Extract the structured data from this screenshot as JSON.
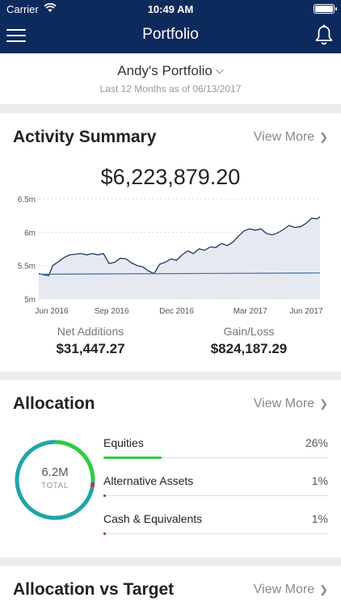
{
  "status_bar": {
    "carrier": "Carrier",
    "time": "10:49 AM"
  },
  "nav": {
    "title": "Portfolio"
  },
  "portfolio": {
    "name": "Andy's Portfolio",
    "subtitle": "Last 12 Months as of 06/13/2017"
  },
  "activity": {
    "title": "Activity Summary",
    "view_more": "View More",
    "total": "$6,223,879.20",
    "net_additions_label": "Net Additions",
    "net_additions_value": "$31,447.27",
    "gain_loss_label": "Gain/Loss",
    "gain_loss_value": "$824,187.29"
  },
  "chart_data": {
    "type": "area",
    "y_ticks": [
      "6.5m",
      "6m",
      "5.5m",
      "5m"
    ],
    "y_tick_values": [
      6.5,
      6.0,
      5.5,
      5.0
    ],
    "ylim": [
      5.0,
      6.5
    ],
    "x_ticks": [
      "Jun 2016",
      "Sep 2016",
      "Dec 2016",
      "Mar 2017",
      "Jun 2017"
    ],
    "x_tick_positions": [
      4.6,
      25.9,
      49.0,
      75.2,
      95.1
    ],
    "series": [
      {
        "kind": "area",
        "color": "#1f3a66",
        "fill": "#e7e9f1",
        "x": [
          0,
          2,
          3.5,
          5,
          7,
          9,
          11,
          13,
          15,
          17,
          19,
          21,
          23,
          25,
          27,
          29,
          31,
          33,
          35,
          37,
          39,
          41,
          43,
          45,
          47,
          49,
          51,
          53,
          55,
          57,
          59,
          61,
          63,
          65,
          67,
          69,
          71,
          73,
          75,
          77,
          79,
          81,
          83,
          85,
          87,
          89,
          91,
          93,
          95,
          97,
          99,
          100
        ],
        "y": [
          5.38,
          5.36,
          5.35,
          5.5,
          5.56,
          5.62,
          5.66,
          5.67,
          5.68,
          5.66,
          5.68,
          5.66,
          5.68,
          5.53,
          5.55,
          5.61,
          5.6,
          5.54,
          5.5,
          5.48,
          5.42,
          5.38,
          5.52,
          5.55,
          5.6,
          5.58,
          5.66,
          5.72,
          5.68,
          5.75,
          5.73,
          5.78,
          5.77,
          5.83,
          5.8,
          5.85,
          5.94,
          6.02,
          6.05,
          6.03,
          6.05,
          5.98,
          5.96,
          5.99,
          6.04,
          6.1,
          6.07,
          6.08,
          6.13,
          6.21,
          6.2,
          6.23
        ]
      },
      {
        "kind": "line",
        "color": "#3c6ea8",
        "x": [
          0,
          100
        ],
        "y": [
          5.37,
          5.39
        ]
      }
    ]
  },
  "allocation": {
    "title": "Allocation",
    "view_more": "View More",
    "center_value": "6.2M",
    "center_label": "TOTAL",
    "items": [
      {
        "name": "Equities",
        "percent": "26%",
        "value": 26,
        "color": "#2ecc40"
      },
      {
        "name": "Alternative Assets",
        "percent": "1%",
        "value": 1,
        "color": "#7b3fb5"
      },
      {
        "name": "Cash & Equivalents",
        "percent": "1%",
        "value": 1,
        "color": "#c0392b"
      }
    ],
    "donut": [
      {
        "value": 26,
        "color": "#2ecc40"
      },
      {
        "value": 1,
        "color": "#7b3fb5"
      },
      {
        "value": 1,
        "color": "#c0392b"
      },
      {
        "value": 72,
        "color": "#1fa5a8"
      }
    ]
  },
  "target": {
    "title": "Allocation vs Target",
    "view_more": "View More"
  },
  "icons": {
    "menu": "menu-icon",
    "bell": "bell-icon",
    "chevron": "chevron-down-icon",
    "arrow": "chevron-right-icon"
  }
}
